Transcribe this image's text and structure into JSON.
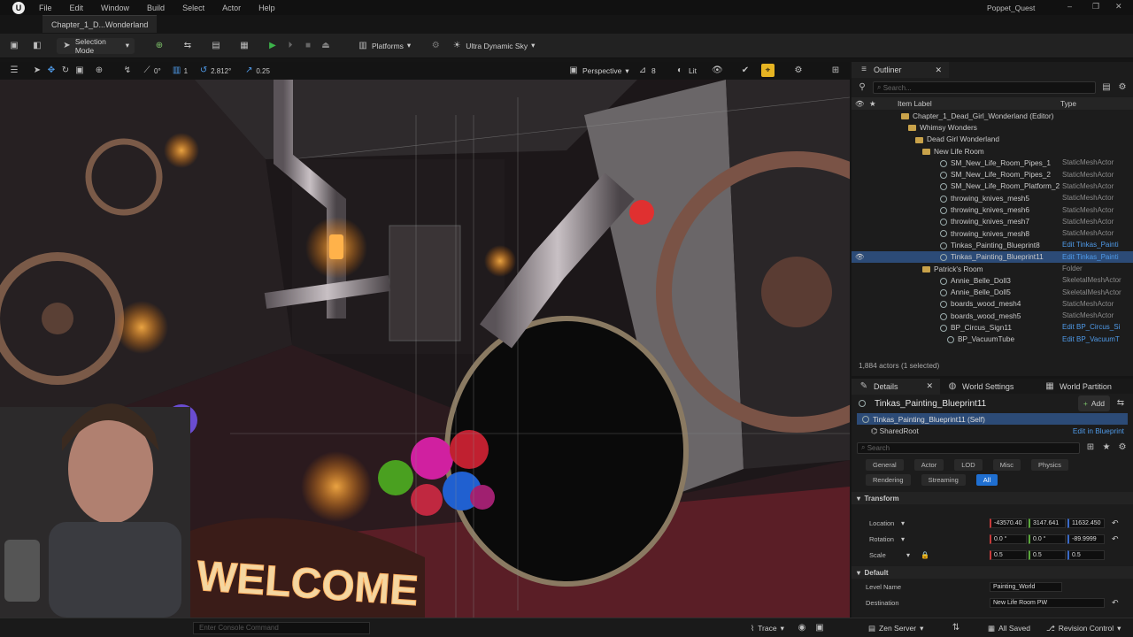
{
  "title_bar": {
    "menus": [
      "File",
      "Edit",
      "Window",
      "Build",
      "Select",
      "Actor",
      "Help"
    ],
    "project": "Poppet_Quest"
  },
  "doc_tab": "Chapter_1_D...Wonderland",
  "toolbar": {
    "selection_mode": "Selection Mode",
    "platforms": "Platforms",
    "sky": "Ultra Dynamic Sky"
  },
  "viewport_toolbar": {
    "snap_angle": "0°",
    "grid": "1",
    "scale": "2.812°",
    "speed": "0.25",
    "view": "Perspective",
    "fov": "8",
    "lighting": "Lit"
  },
  "viewport": {
    "sign_text": "WELCOME"
  },
  "outliner": {
    "tab_title": "Outliner",
    "search_placeholder": "Search...",
    "col_label": "Item Label",
    "col_type": "Type",
    "items": [
      {
        "label": "Chapter_1_Dead_Girl_Wonderland (Editor)",
        "type": "",
        "kind": "level",
        "depth": 0
      },
      {
        "label": "Whimsy Wonders",
        "type": "",
        "kind": "folder",
        "depth": 1
      },
      {
        "label": "Dead Girl Wonderland",
        "type": "",
        "kind": "folder",
        "depth": 2
      },
      {
        "label": "New Life Room",
        "type": "",
        "kind": "folder",
        "depth": 3
      },
      {
        "label": "SM_New_Life_Room_Pipes_1",
        "type": "StaticMeshActor",
        "kind": "mesh",
        "depth": 4
      },
      {
        "label": "SM_New_Life_Room_Pipes_2",
        "type": "StaticMeshActor",
        "kind": "mesh",
        "depth": 4
      },
      {
        "label": "SM_New_Life_Room_Platform_2",
        "type": "StaticMeshActor",
        "kind": "mesh",
        "depth": 4
      },
      {
        "label": "throwing_knives_mesh5",
        "type": "StaticMeshActor",
        "kind": "mesh",
        "depth": 4
      },
      {
        "label": "throwing_knives_mesh6",
        "type": "StaticMeshActor",
        "kind": "mesh",
        "depth": 4
      },
      {
        "label": "throwing_knives_mesh7",
        "type": "StaticMeshActor",
        "kind": "mesh",
        "depth": 4
      },
      {
        "label": "throwing_knives_mesh8",
        "type": "StaticMeshActor",
        "kind": "mesh",
        "depth": 4
      },
      {
        "label": "Tinkas_Painting_Blueprint8",
        "type": "Edit Tinkas_Painti",
        "kind": "mesh",
        "depth": 4,
        "link": true
      },
      {
        "label": "Tinkas_Painting_Blueprint11",
        "type": "Edit Tinkas_Painti",
        "kind": "mesh",
        "depth": 4,
        "link": true,
        "selected": true
      },
      {
        "label": "Patrick's Room",
        "type": "Folder",
        "kind": "folder",
        "depth": 3
      },
      {
        "label": "Annie_Belle_Doll3",
        "type": "SkeletalMeshActor",
        "kind": "mesh",
        "depth": 4
      },
      {
        "label": "Annie_Belle_Doll5",
        "type": "SkeletalMeshActor",
        "kind": "mesh",
        "depth": 4
      },
      {
        "label": "boards_wood_mesh4",
        "type": "StaticMeshActor",
        "kind": "mesh",
        "depth": 4
      },
      {
        "label": "boards_wood_mesh5",
        "type": "StaticMeshActor",
        "kind": "mesh",
        "depth": 4
      },
      {
        "label": "BP_Circus_Sign11",
        "type": "Edit BP_Circus_Si",
        "kind": "mesh",
        "depth": 4,
        "link": true
      },
      {
        "label": "BP_VacuumTube",
        "type": "Edit BP_VacuumT",
        "kind": "mesh",
        "depth": 5,
        "link": true
      }
    ],
    "actor_count": "1,884 actors (1 selected)"
  },
  "details": {
    "tabs": [
      "Details",
      "World Settings",
      "World Partition"
    ],
    "actor_name": "Tinkas_Painting_Blueprint11",
    "add_label": "Add",
    "self_row": "Tinkas_Painting_Blueprint11 (Self)",
    "shared_root": "SharedRoot",
    "edit_blueprint": "Edit in Blueprint",
    "search_placeholder": "Search",
    "filters": [
      "General",
      "Actor",
      "LOD",
      "Misc",
      "Physics",
      "Rendering",
      "Streaming",
      "All"
    ],
    "transform_header": "Transform",
    "location_label": "Location",
    "location": [
      "-43570.40",
      "3147.641",
      "11632.450"
    ],
    "rotation_label": "Rotation",
    "rotation": [
      "0.0 °",
      "0.0 °",
      "-89.9999"
    ],
    "scale_label": "Scale",
    "scale": [
      "0.5",
      "0.5",
      "0.5"
    ],
    "default_header": "Default",
    "level_name_label": "Level Name",
    "level_name": "Painting_World",
    "destination_label": "Destination",
    "destination": "New Life Room PW"
  },
  "status_bar": {
    "console_placeholder": "Enter Console Command",
    "trace": "Trace",
    "zen": "Zen Server",
    "saved": "All Saved",
    "revision": "Revision Control"
  },
  "colors": {
    "accent": "#1f6fd1",
    "selection": "#2c4b77",
    "play": "#3cb34a",
    "link": "#4f9ae8"
  }
}
